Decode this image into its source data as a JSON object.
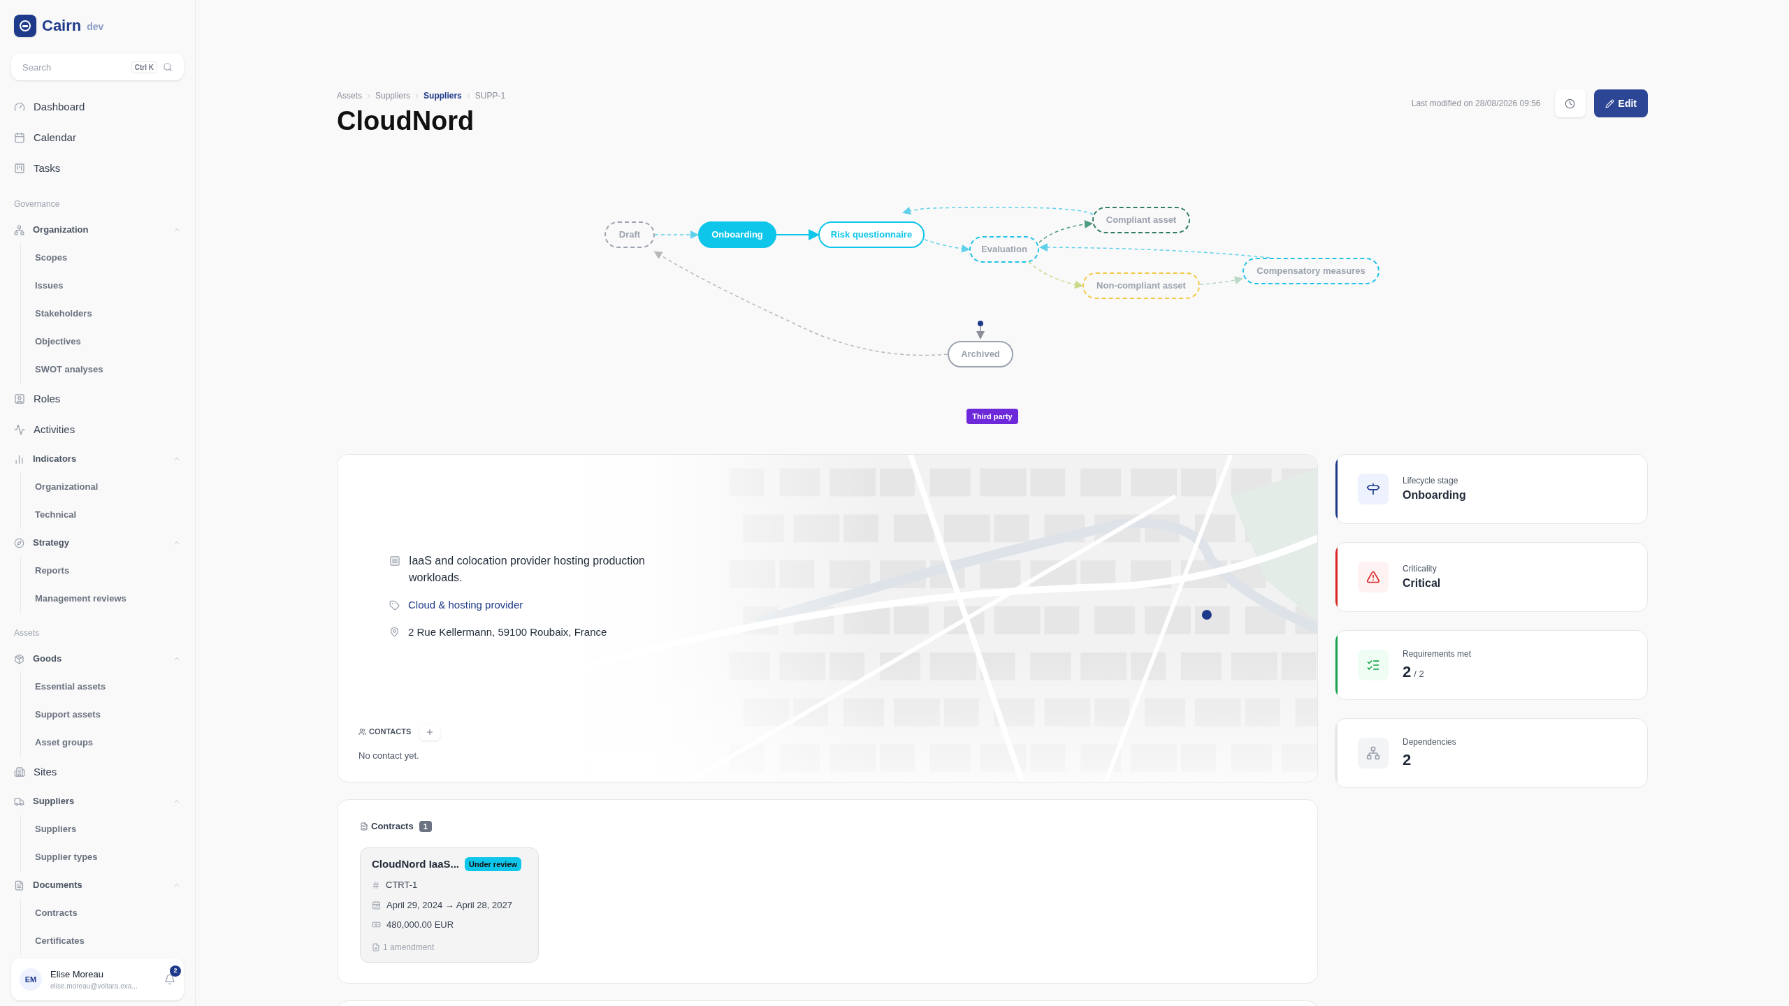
{
  "app": {
    "name": "Cairn",
    "env": "dev"
  },
  "search": {
    "placeholder": "Search",
    "shortcut": "Ctrl K"
  },
  "sidebar": {
    "sections": [
      {
        "items": [
          {
            "label": "Dashboard",
            "kind": "link"
          },
          {
            "label": "Calendar",
            "kind": "link"
          },
          {
            "label": "Tasks",
            "kind": "link"
          }
        ]
      },
      {
        "title": "Governance",
        "items": [
          {
            "label": "Organization",
            "kind": "group",
            "expanded": true,
            "children": [
              {
                "label": "Scopes"
              },
              {
                "label": "Issues"
              },
              {
                "label": "Stakeholders"
              },
              {
                "label": "Objectives"
              },
              {
                "label": "SWOT analyses"
              }
            ]
          },
          {
            "label": "Roles",
            "kind": "link"
          },
          {
            "label": "Activities",
            "kind": "link"
          },
          {
            "label": "Indicators",
            "kind": "group",
            "expanded": true,
            "children": [
              {
                "label": "Organizational"
              },
              {
                "label": "Technical"
              }
            ]
          },
          {
            "label": "Strategy",
            "kind": "group",
            "expanded": true,
            "children": [
              {
                "label": "Reports"
              },
              {
                "label": "Management reviews"
              }
            ]
          }
        ]
      },
      {
        "title": "Assets",
        "items": [
          {
            "label": "Goods",
            "kind": "group",
            "expanded": true,
            "children": [
              {
                "label": "Essential assets"
              },
              {
                "label": "Support assets"
              },
              {
                "label": "Asset groups"
              }
            ]
          },
          {
            "label": "Sites",
            "kind": "link"
          },
          {
            "label": "Suppliers",
            "kind": "group",
            "expanded": true,
            "children": [
              {
                "label": "Suppliers"
              },
              {
                "label": "Supplier types"
              }
            ]
          },
          {
            "label": "Documents",
            "kind": "group",
            "expanded": true,
            "children": [
              {
                "label": "Contracts"
              },
              {
                "label": "Certificates"
              }
            ]
          }
        ]
      }
    ]
  },
  "user": {
    "initials": "EM",
    "name": "Elise Moreau",
    "email": "elise.moreau@voltara.exa...",
    "notifications": "2"
  },
  "breadcrumb": [
    {
      "label": "Assets",
      "highlighted": false
    },
    {
      "label": "Suppliers",
      "highlighted": false
    },
    {
      "label": "Suppliers",
      "highlighted": true
    },
    {
      "label": "SUPP-1",
      "highlighted": false
    }
  ],
  "title": "CloudNord",
  "last_modified": "Last modified on 28/08/2026 09:56",
  "edit_button": "Edit",
  "workflow": {
    "nodes": [
      {
        "label": "Draft",
        "kind": "dashed",
        "selected": false,
        "color": "#9ca3af"
      },
      {
        "label": "Onboarding",
        "kind": "solid",
        "selected": true,
        "color": "#0ec5ea"
      },
      {
        "label": "Risk questionnaire",
        "kind": "solid",
        "selected": false,
        "color": "#0ec5ea"
      },
      {
        "label": "Evaluation",
        "kind": "dashed",
        "selected": false,
        "color": "#22c3e6"
      },
      {
        "label": "Compliant asset",
        "kind": "dashed",
        "selected": false,
        "color": "#2f7d5e"
      },
      {
        "label": "Non-compliant asset",
        "kind": "dashed",
        "selected": false,
        "color": "#f2c744"
      },
      {
        "label": "Compensatory measures",
        "kind": "dashed",
        "selected": false,
        "color": "#22c3e6"
      },
      {
        "label": "Archived",
        "kind": "solid",
        "selected": false,
        "color": "#9ca3af"
      }
    ],
    "badge": "Third party"
  },
  "details": {
    "description": "IaaS and colocation provider hosting production workloads.",
    "category": "Cloud & hosting provider",
    "address": "2 Rue Kellermann, 59100 Roubaix, France"
  },
  "contacts": {
    "title": "CONTACTS",
    "empty": "No contact yet."
  },
  "stats": [
    {
      "label": "Lifecycle stage",
      "value": "Onboarding",
      "color": "#1e3a8a"
    },
    {
      "label": "Criticality",
      "value": "Critical",
      "color": "#dc2626"
    },
    {
      "label": "Requirements met",
      "value": "2",
      "total": "/ 2",
      "color": "#16a34a"
    },
    {
      "label": "Dependencies",
      "value": "2",
      "color": "#e5e7eb"
    }
  ],
  "contracts": {
    "title": "Contracts",
    "count": "1",
    "items": [
      {
        "name": "CloudNord IaaS...",
        "status": "Under review",
        "reference": "CTRT-1",
        "period": "April 29, 2024 → April 28, 2027",
        "amount": "480,000.00 EUR",
        "amendments": "1 amendment"
      }
    ]
  }
}
